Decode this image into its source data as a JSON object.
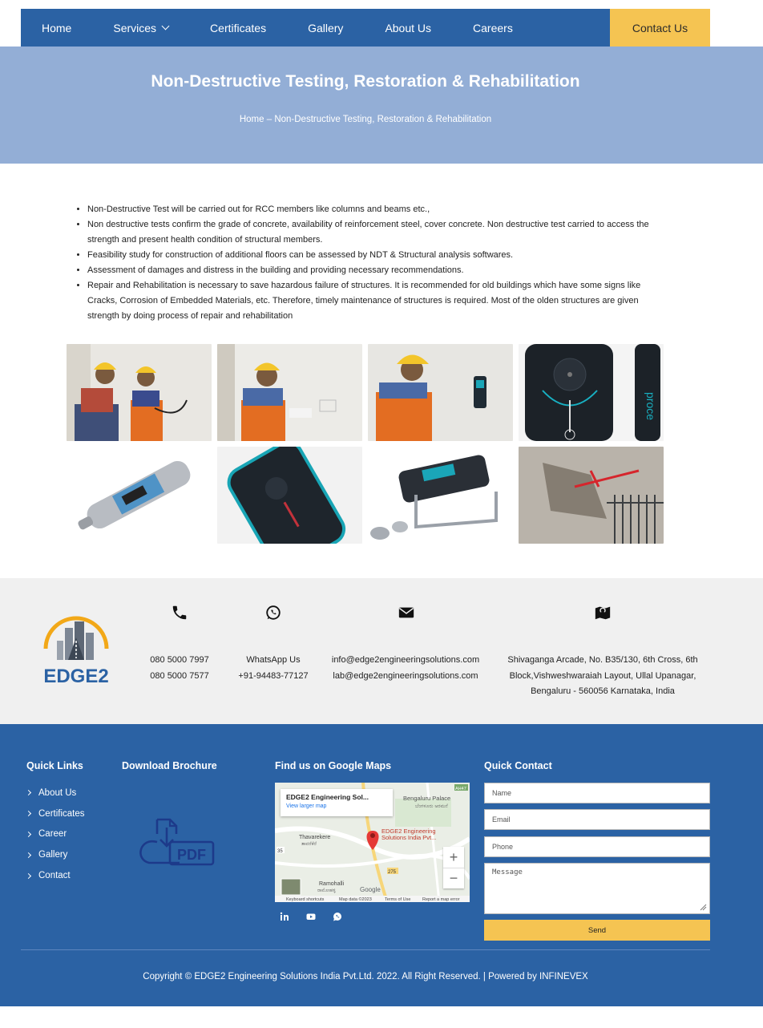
{
  "nav": {
    "items": [
      "Home",
      "Services",
      "Certificates",
      "Gallery",
      "About Us",
      "Careers"
    ],
    "contact_label": "Contact Us"
  },
  "hero": {
    "title": "Non-Destructive Testing, Restoration & Rehabilitation",
    "breadcrumb": "Home – Non-Destructive Testing, Restoration & Rehabilitation"
  },
  "content": {
    "bullets": [
      "Non-Destructive Test will be carried out for RCC members like columns and beams etc.,",
      "Non destructive tests confirm the grade of concrete, availability of reinforcement steel, cover concrete. Non destructive test carried to access the strength and present health condition of structural members.",
      "Feasibility study for construction of additional floors can be assessed by NDT & Structural analysis softwares.",
      "Assessment of damages and distress in the building and providing necessary recommendations.",
      "Repair and Rehabilitation is necessary to save hazardous failure of structures. It is recommended for old buildings which have some signs like Cracks, Corrosion of Embedded Materials, etc. Therefore, timely maintenance of structures is required. Most of the olden structures are given strength by doing process of repair and rehabilitation"
    ]
  },
  "gallery": {
    "tiles": [
      "engineers-testing-wall",
      "engineer-testing-wall-closeup",
      "engineer-scanning-wall",
      "profoscope-device-closeup",
      "rebound-hammer",
      "profoscope-device",
      "pull-off-tester",
      "damaged-concrete-slab"
    ]
  },
  "contact": {
    "logo_text": "EDGE2",
    "phone": [
      "080 5000 7997",
      "080 5000 7577"
    ],
    "whatsapp": [
      "WhatsApp Us",
      "+91-94483-77127"
    ],
    "email": [
      "info@edge2engineeringsolutions.com",
      "lab@edge2engineeringsolutions.com"
    ],
    "address": [
      "Shivaganga Arcade, No. B35/130, 6th Cross, 6th",
      "Block,Vishweshwaraiah Layout, Ullal Upanagar,",
      "Bengaluru - 560056 Karnataka, India"
    ]
  },
  "footer": {
    "quick_links_title": "Quick Links",
    "quick_links": [
      "About Us",
      "Certificates",
      "Career",
      "Gallery",
      "Contact"
    ],
    "brochure_title": "Download Brochure",
    "pdf_label": "PDF",
    "maps_title": "Find us on Google Maps",
    "map": {
      "place_name": "EDGE2 Engineering Sol...",
      "larger_map": "View larger map",
      "pin_label_1": "EDGE2 Engineering",
      "pin_label_2": "Solutions India Pvt...",
      "area_1": "Bengaluru Palace",
      "area_1_local": "ಬೆಂಗಳೂರು ಅರಮನೆ",
      "area_2": "Thavarekere",
      "area_2_local": "ತಾವರೆಕೆರೆ",
      "area_3": "Ramohalli",
      "area_3_local": "ರಾಮೋಹಳ್ಳಿ",
      "road_1": "35",
      "road_2": "275",
      "road_3": "AH47",
      "attribution": [
        "Keyboard shortcuts",
        "Map data ©2023",
        "Terms of Use",
        "Report a map error"
      ],
      "google": "Google"
    },
    "social": [
      "linkedin-icon",
      "youtube-icon",
      "whatsapp-icon"
    ],
    "quick_contact_title": "Quick Contact",
    "form": {
      "name_placeholder": "Name",
      "email_placeholder": "Email",
      "phone_placeholder": "Phone",
      "message_placeholder": "Message",
      "send_label": "Send"
    },
    "copyright": "Copyright © EDGE2 Engineering Solutions India Pvt.Ltd. 2022. All Right Reserved. | Powered by INFINEVEX"
  },
  "colors": {
    "primary": "#2b62a4",
    "accent": "#f5c452",
    "hero": "#93aed6",
    "strip": "#f0f0f0"
  }
}
